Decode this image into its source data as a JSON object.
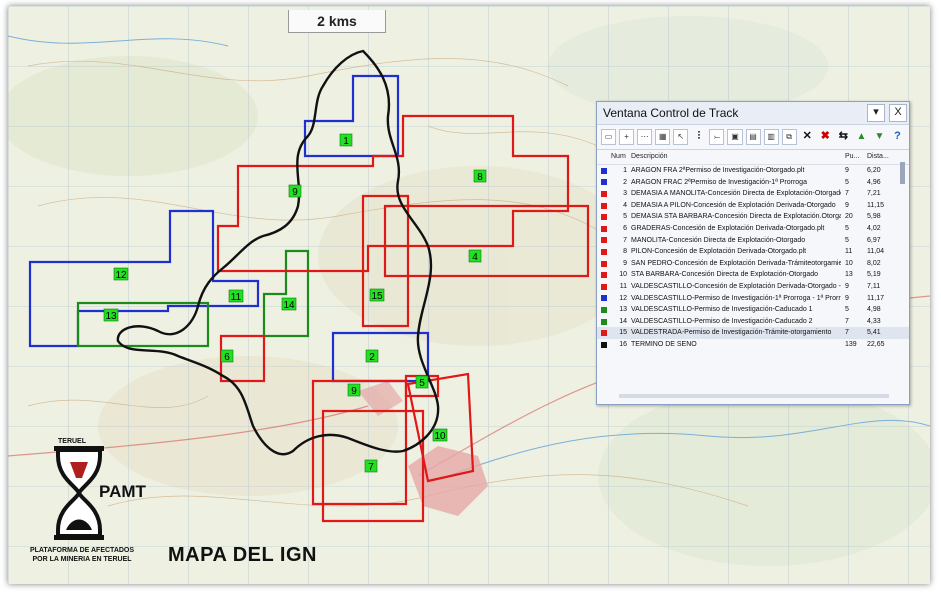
{
  "map": {
    "scale_label": "2 kms",
    "source_label": "MAPA DEL IGN",
    "colors": {
      "background": "#eef0e2",
      "red": "#e01818",
      "blue": "#1f2fd0",
      "green": "#1c8a1c",
      "track": "#111111",
      "label_box": "#22e022"
    },
    "polygon_labels": [
      "1",
      "2",
      "4",
      "6",
      "7",
      "8",
      "9",
      "9",
      "10",
      "11",
      "12",
      "13",
      "14",
      "15",
      "5"
    ]
  },
  "logo": {
    "region": "TERUEL",
    "abbr": "PAMT",
    "org_line1": "PLATAFORMA DE AFECTADOS",
    "org_line2": "POR LA MINERIA EN TERUEL"
  },
  "track_window": {
    "title": "Ventana Control de Track",
    "buttons": {
      "pin": "▾",
      "close": "X"
    },
    "columns": {
      "num": "Num",
      "desc": "Descripción",
      "pu": "Pu...",
      "dist": "Dista..."
    },
    "rows": [
      {
        "num": "1",
        "desc": "ARAGON FRA 2ªPermiso de Investigación-Otorgado.plt",
        "pu": "9",
        "dist": "6,20",
        "color": "#1f2fd0"
      },
      {
        "num": "2",
        "desc": "ARAGON FRAC 2ªPermiso de Investigación-1ª Prorroga",
        "pu": "5",
        "dist": "4,96",
        "color": "#1f2fd0"
      },
      {
        "num": "3",
        "desc": "DEMASIA A MANOLITA-Concesión Directa de Explotación-Otorgado",
        "pu": "7",
        "dist": "7,21",
        "color": "#e01818"
      },
      {
        "num": "4",
        "desc": "DEMASIA A PILON-Concesión de Explotación Derivada-Otorgado",
        "pu": "9",
        "dist": "11,15",
        "color": "#e01818"
      },
      {
        "num": "5",
        "desc": "DEMASIA STA BARBARA-Concesión Directa de Explotación.Otorgado",
        "pu": "20",
        "dist": "5,98",
        "color": "#e01818"
      },
      {
        "num": "6",
        "desc": "GRADERAS-Concesión de Explotación Derivada-Otorgado.plt",
        "pu": "5",
        "dist": "4,02",
        "color": "#e01818"
      },
      {
        "num": "7",
        "desc": "MANOLITA-Concesión Directa de Explotación-Otorgado",
        "pu": "5",
        "dist": "6,97",
        "color": "#e01818"
      },
      {
        "num": "8",
        "desc": "PILON-Concesión de Explotación Derivada-Otorgado.plt",
        "pu": "11",
        "dist": "11,04",
        "color": "#e01818"
      },
      {
        "num": "9",
        "desc": "SAN PEDRO-Concesión de Explotación Derivada-Trámiteotorgamiento",
        "pu": "10",
        "dist": "8,02",
        "color": "#e01818"
      },
      {
        "num": "10",
        "desc": "STA BARBARA-Concesión Directa de Explotación-Otorgado",
        "pu": "13",
        "dist": "5,19",
        "color": "#e01818"
      },
      {
        "num": "11",
        "desc": "VALDESCASTILLO-Concesión de Explotación Derivada-Otorgado -",
        "pu": "9",
        "dist": "7,11",
        "color": "#e01818"
      },
      {
        "num": "12",
        "desc": "VALDESCASTILLO-Permiso de Investigación-1ª Prorroga - 1ª Prorr",
        "pu": "9",
        "dist": "11,17",
        "color": "#1f2fd0"
      },
      {
        "num": "13",
        "desc": "VALDESCASTILLO-Permiso de Investigación-Caducado 1",
        "pu": "5",
        "dist": "4,98",
        "color": "#1c8a1c"
      },
      {
        "num": "14",
        "desc": "VALDESCASTILLO-Permiso de Investigación-Caducado 2",
        "pu": "7",
        "dist": "4,33",
        "color": "#1c8a1c"
      },
      {
        "num": "15",
        "desc": "VALDESTRADA-Permiso de Investigación-Trámite-otorgamiento",
        "pu": "7",
        "dist": "5,41",
        "color": "#e01818",
        "selected": true
      },
      {
        "num": "16",
        "desc": "TERMINO DE SENO",
        "pu": "139",
        "dist": "22,65",
        "color": "#111111"
      }
    ]
  }
}
